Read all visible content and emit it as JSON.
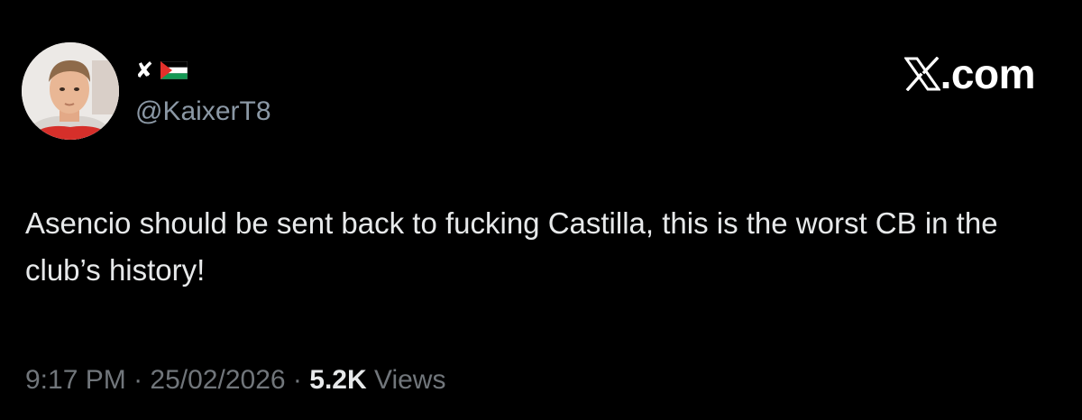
{
  "author": {
    "display_name_symbol": "✘",
    "flag_icon": "palestine-flag-icon",
    "handle": "@KaixerT8",
    "avatar_icon": "profile-photo"
  },
  "brand": {
    "logo_letter": "𝕏",
    "text": ".com"
  },
  "tweet": {
    "text": "Asencio should be sent back to fucking Castilla, this is the worst CB in the club’s history!"
  },
  "meta": {
    "time": "9:17 PM",
    "separator": "·",
    "date": "25/02/2026",
    "views_count": "5.2K",
    "views_label": "Views"
  },
  "colors": {
    "background": "#000000",
    "primary_text": "#e7e9ea",
    "secondary_text": "#71767b",
    "handle_text": "#8b98a5"
  }
}
